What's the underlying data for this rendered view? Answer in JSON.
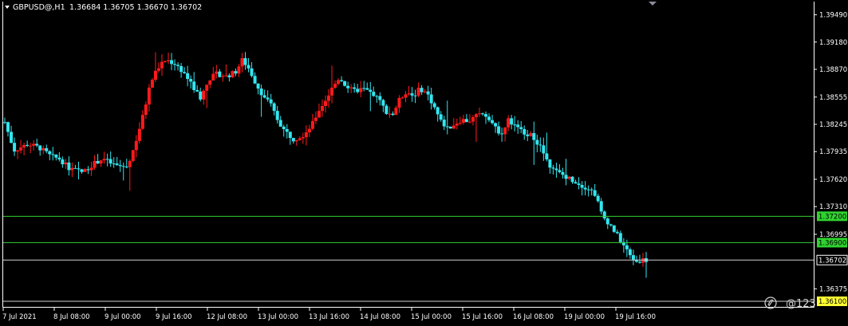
{
  "header": {
    "symbol": "GBPUSD@,H1",
    "ohlc": "1.36684 1.36705 1.36670 1.36702"
  },
  "watermark": "@123",
  "colors": {
    "background": "#000000",
    "bull": "#ff1a1a",
    "bear": "#33e6f0",
    "level_line": "#2fd32f",
    "level_label_bg": "#2fd32f",
    "bid_line": "#cfcfcf",
    "yellow_label_bg": "#ffff33",
    "axis": "#ffffff"
  },
  "chart_data": {
    "type": "candlestick",
    "symbol": "GBPUSD@",
    "timeframe": "H1",
    "y_ticks": [
      "1.39490",
      "1.39180",
      "1.38870",
      "1.38555",
      "1.38245",
      "1.37935",
      "1.37620",
      "1.37310",
      "1.36995",
      "1.36375"
    ],
    "x_ticks": [
      "7 Jul 2021",
      "8 Jul 08:00",
      "9 Jul 00:00",
      "9 Jul 16:00",
      "12 Jul 08:00",
      "13 Jul 00:00",
      "13 Jul 16:00",
      "14 Jul 08:00",
      "15 Jul 00:00",
      "15 Jul 16:00",
      "16 Jul 08:00",
      "19 Jul 00:00",
      "19 Jul 16:00"
    ],
    "ylim": [
      1.3617,
      1.3964
    ],
    "horizontal_levels": [
      {
        "label": "1.37200",
        "value": 1.372,
        "kind": "level"
      },
      {
        "label": "1.36900",
        "value": 1.369,
        "kind": "level"
      },
      {
        "label": "1.36702",
        "value": 1.36702,
        "kind": "bid"
      },
      {
        "label": "1.36100",
        "value": 1.361,
        "kind": "yellow"
      }
    ],
    "close_path": [
      [
        0,
        1.3827
      ],
      [
        8,
        1.3795
      ],
      [
        20,
        1.3802
      ],
      [
        30,
        1.3798
      ],
      [
        40,
        1.3788
      ],
      [
        48,
        1.3785
      ],
      [
        55,
        1.3775
      ],
      [
        62,
        1.3772
      ],
      [
        68,
        1.377
      ],
      [
        75,
        1.3778
      ],
      [
        85,
        1.3786
      ],
      [
        92,
        1.378
      ],
      [
        98,
        1.3777
      ],
      [
        106,
        1.3776
      ],
      [
        112,
        1.3798
      ],
      [
        120,
        1.3835
      ],
      [
        126,
        1.387
      ],
      [
        132,
        1.3888
      ],
      [
        140,
        1.3898
      ],
      [
        148,
        1.3893
      ],
      [
        156,
        1.3882
      ],
      [
        164,
        1.3865
      ],
      [
        170,
        1.3854
      ],
      [
        176,
        1.3875
      ],
      [
        184,
        1.3882
      ],
      [
        192,
        1.3879
      ],
      [
        200,
        1.3884
      ],
      [
        206,
        1.3898
      ],
      [
        212,
        1.3887
      ],
      [
        218,
        1.387
      ],
      [
        224,
        1.3857
      ],
      [
        230,
        1.3848
      ],
      [
        236,
        1.3831
      ],
      [
        242,
        1.3818
      ],
      [
        250,
        1.3808
      ],
      [
        258,
        1.3812
      ],
      [
        266,
        1.3823
      ],
      [
        272,
        1.384
      ],
      [
        278,
        1.3852
      ],
      [
        284,
        1.3866
      ],
      [
        290,
        1.3878
      ],
      [
        296,
        1.3868
      ],
      [
        302,
        1.3862
      ],
      [
        310,
        1.3865
      ],
      [
        318,
        1.386
      ],
      [
        324,
        1.3853
      ],
      [
        330,
        1.384
      ],
      [
        336,
        1.3835
      ],
      [
        342,
        1.3852
      ],
      [
        348,
        1.3862
      ],
      [
        354,
        1.3857
      ],
      [
        360,
        1.3865
      ],
      [
        366,
        1.386
      ],
      [
        372,
        1.3845
      ],
      [
        378,
        1.3828
      ],
      [
        384,
        1.382
      ],
      [
        390,
        1.3825
      ],
      [
        396,
        1.383
      ],
      [
        402,
        1.3828
      ],
      [
        408,
        1.3833
      ],
      [
        414,
        1.3838
      ],
      [
        420,
        1.3832
      ],
      [
        426,
        1.3818
      ],
      [
        432,
        1.3815
      ],
      [
        436,
        1.383
      ],
      [
        440,
        1.3825
      ],
      [
        446,
        1.3818
      ],
      [
        452,
        1.3815
      ],
      [
        458,
        1.381
      ],
      [
        464,
        1.38
      ],
      [
        470,
        1.3782
      ],
      [
        476,
        1.3772
      ],
      [
        482,
        1.3768
      ],
      [
        488,
        1.3764
      ],
      [
        494,
        1.376
      ],
      [
        500,
        1.3755
      ],
      [
        506,
        1.3752
      ],
      [
        512,
        1.3745
      ],
      [
        518,
        1.372
      ],
      [
        524,
        1.3712
      ],
      [
        530,
        1.37
      ],
      [
        536,
        1.3688
      ],
      [
        542,
        1.3675
      ],
      [
        548,
        1.3668
      ],
      [
        552,
        1.3671
      ],
      [
        556,
        1.367
      ]
    ]
  }
}
